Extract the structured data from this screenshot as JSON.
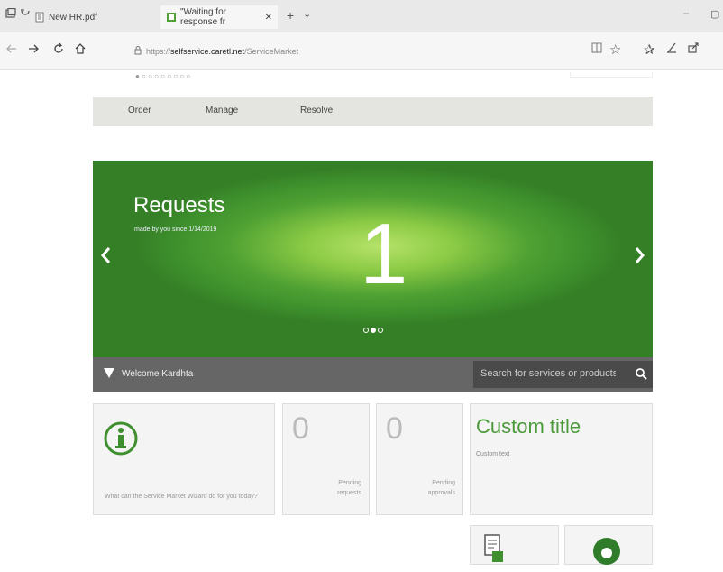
{
  "browser": {
    "tabs": [
      {
        "label": "New HR.pdf"
      },
      {
        "label": "\"Waiting for response fr",
        "active": true
      }
    ],
    "new_tab_symbol": "+",
    "tab_menu_symbol": "⌄",
    "close_tab_symbol": "✕",
    "url_prefix": "https://",
    "url_domain": "selfservice.caretl.net",
    "url_path": "/ServiceMarket",
    "window_controls": {
      "minimize": "–",
      "restore": "▢"
    }
  },
  "page": {
    "topline": "● ○ ○ ○ ○ ○ ○ ○ ○",
    "menu": [
      {
        "label": "Order"
      },
      {
        "label": "Manage"
      },
      {
        "label": "Resolve"
      }
    ],
    "banner": {
      "title": "Requests",
      "subtitle": "made by you since 1/14/2019",
      "number": "1",
      "accent": "#4fa133"
    },
    "welcome": {
      "label": "Welcome Kardhta",
      "search_placeholder": "Search for services or products"
    },
    "tiles": {
      "info_caption": "What can the Service Market Wizard do for you today?",
      "pending_requests": {
        "count": "0",
        "label_line1": "Pending",
        "label_line2": "requests"
      },
      "pending_approvals": {
        "count": "0",
        "label_line1": "Pending",
        "label_line2": "approvals"
      },
      "custom": {
        "title": "Custom title",
        "text": "Custom text"
      }
    }
  }
}
